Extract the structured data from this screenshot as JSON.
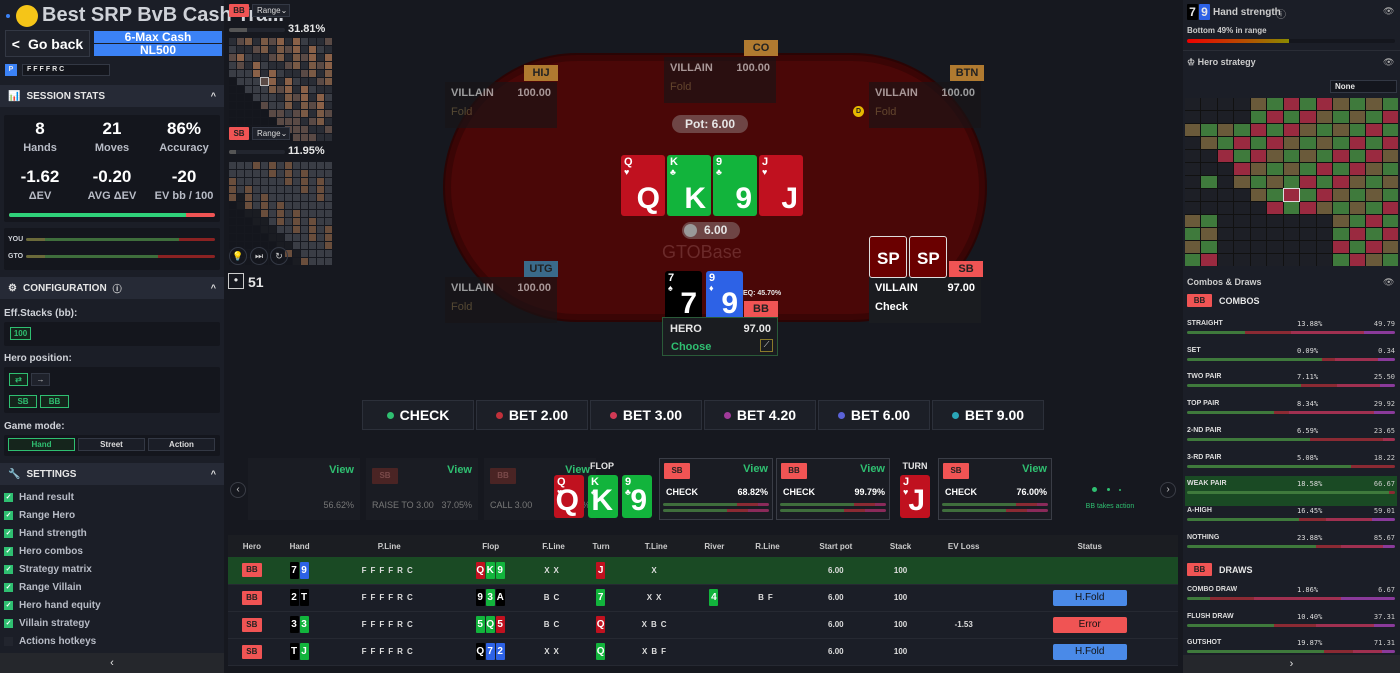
{
  "header": {
    "title": "Best SRP BvB Cash Tra...",
    "go_back": "Go back",
    "game_type": "6-Max Cash",
    "stakes": "NL500",
    "line_badge": "P",
    "line": "FFFFRC"
  },
  "session_stats": {
    "title": "SESSION STATS",
    "stats": [
      {
        "value": "8",
        "label": "Hands"
      },
      {
        "value": "21",
        "label": "Moves"
      },
      {
        "value": "86%",
        "label": "Accuracy"
      },
      {
        "value": "-1.62",
        "label": "ΔEV"
      },
      {
        "value": "-0.20",
        "label": "AVG ΔEV"
      },
      {
        "value": "-20",
        "label": "EV bb / 100"
      }
    ],
    "accuracy_fraction": 0.86,
    "you_label": "YOU",
    "gto_label": "GTO"
  },
  "configuration": {
    "title": "CONFIGURATION",
    "eff_stacks_label": "Eff.Stacks (bb):",
    "eff_stacks": "100",
    "hero_position_label": "Hero position:",
    "positions": [
      "SB",
      "BB"
    ],
    "game_mode_label": "Game mode:",
    "modes": [
      "Hand",
      "Street",
      "Action"
    ],
    "active_mode": "Hand"
  },
  "settings": {
    "title": "SETTINGS",
    "items": [
      {
        "label": "Hand result",
        "checked": true
      },
      {
        "label": "Range Hero",
        "checked": true
      },
      {
        "label": "Hand strength",
        "checked": true
      },
      {
        "label": "Hero combos",
        "checked": true
      },
      {
        "label": "Strategy matrix",
        "checked": true
      },
      {
        "label": "Range Villain",
        "checked": true
      },
      {
        "label": "Hero hand equity",
        "checked": true
      },
      {
        "label": "Villain strategy",
        "checked": true
      },
      {
        "label": "Actions hotkeys",
        "checked": false
      }
    ]
  },
  "ranges": [
    {
      "pos": "BB",
      "select": "Range",
      "pct": "31.81%",
      "fill": 0.3181
    },
    {
      "pos": "SB",
      "select": "Range",
      "pct": "11.95%",
      "fill": 0.1195
    }
  ],
  "counter": "51",
  "table": {
    "pot": "Pot: 6.00",
    "bet": "6.00",
    "logo": "GTOBase",
    "seats": [
      {
        "pos": "HIJ",
        "name": "VILLAIN",
        "stack": "100.00",
        "action": "Fold"
      },
      {
        "pos": "CO",
        "name": "VILLAIN",
        "stack": "100.00",
        "action": "Fold"
      },
      {
        "pos": "BTN",
        "name": "VILLAIN",
        "stack": "100.00",
        "action": "Fold"
      },
      {
        "pos": "UTG",
        "name": "VILLAIN",
        "stack": "100.00",
        "action": "Fold"
      },
      {
        "pos": "SB",
        "name": "VILLAIN",
        "stack": "97.00",
        "action": "Check"
      }
    ],
    "hero": {
      "pos": "BB",
      "name": "HERO",
      "stack": "97.00",
      "action": "Choose",
      "equity": "EQ: 45.70%",
      "cards": [
        {
          "rank": "7",
          "suit": "s"
        },
        {
          "rank": "9",
          "suit": "d"
        }
      ]
    },
    "dealer": "D",
    "villain_cards": [
      "SP",
      "SP"
    ],
    "board": [
      {
        "rank": "Q",
        "suit": "h"
      },
      {
        "rank": "K",
        "suit": "c"
      },
      {
        "rank": "9",
        "suit": "c"
      },
      {
        "rank": "J",
        "suit": "h"
      }
    ]
  },
  "actions": [
    {
      "label": "CHECK",
      "color": "#2fbf71"
    },
    {
      "label": "BET 2.00",
      "color": "#c0303a"
    },
    {
      "label": "BET 3.00",
      "color": "#d13a55"
    },
    {
      "label": "BET 4.20",
      "color": "#a03a9a"
    },
    {
      "label": "BET 6.00",
      "color": "#5a62d8"
    },
    {
      "label": "BET 9.00",
      "color": "#2aa6b8"
    }
  ],
  "timeline": {
    "view": "View",
    "preflop": [
      {
        "pos": "",
        "action": "",
        "pct": "56.62%"
      },
      {
        "pos": "SB",
        "action": "RAISE TO 3.00",
        "pct": "37.05%"
      },
      {
        "pos": "BB",
        "action": "CALL 3.00",
        "pct": "40.84%"
      }
    ],
    "flop_label": "FLOP",
    "turn_label": "TURN",
    "flop": [
      {
        "rank": "Q",
        "suit": "h"
      },
      {
        "rank": "K",
        "suit": "c"
      },
      {
        "rank": "9",
        "suit": "c"
      }
    ],
    "turn": [
      {
        "rank": "J",
        "suit": "h"
      }
    ],
    "street_actions": [
      {
        "pos": "SB",
        "action": "CHECK",
        "pct": "68.82%"
      },
      {
        "pos": "BB",
        "action": "CHECK",
        "pct": "99.79%"
      },
      {
        "pos": "SB",
        "action": "CHECK",
        "pct": "76.00%"
      }
    ],
    "status": "BB takes action"
  },
  "history": {
    "columns": [
      "Hero",
      "Hand",
      "P.Line",
      "Flop",
      "F.Line",
      "Turn",
      "T.Line",
      "River",
      "R.Line",
      "Start pot",
      "Stack",
      "EV Loss",
      "Status"
    ],
    "rows": [
      {
        "hero": "BB",
        "hand": [
          [
            "7",
            "s"
          ],
          [
            "9",
            "d"
          ]
        ],
        "pline": "FFFFRC",
        "flop": [
          [
            "Q",
            "h"
          ],
          [
            "K",
            "c"
          ],
          [
            "9",
            "c"
          ]
        ],
        "fline": "XX",
        "turn": [
          [
            "J",
            "h"
          ]
        ],
        "tline": "X",
        "river": [],
        "rline": "",
        "pot": "6.00",
        "stack": "100",
        "ev": "",
        "status": "",
        "current": true
      },
      {
        "hero": "BB",
        "hand": [
          [
            "2",
            "s"
          ],
          [
            "T",
            "s"
          ]
        ],
        "pline": "FFFFRC",
        "flop": [
          [
            "9",
            "s"
          ],
          [
            "3",
            "c"
          ],
          [
            "A",
            "s"
          ]
        ],
        "fline": "BC",
        "turn": [
          [
            "7",
            "c"
          ]
        ],
        "tline": "XX",
        "river": [
          [
            "4",
            "c"
          ]
        ],
        "rline": "BF",
        "pot": "6.00",
        "stack": "100",
        "ev": "",
        "status": "H.Fold"
      },
      {
        "hero": "SB",
        "hand": [
          [
            "3",
            "s"
          ],
          [
            "3",
            "c"
          ]
        ],
        "pline": "FFFFRC",
        "flop": [
          [
            "5",
            "c"
          ],
          [
            "Q",
            "c"
          ],
          [
            "5",
            "h"
          ]
        ],
        "fline": "BC",
        "turn": [
          [
            "Q",
            "h"
          ]
        ],
        "tline": "XBC",
        "river": [],
        "rline": "",
        "pot": "6.00",
        "stack": "100",
        "ev": "-1.53",
        "status": "Error"
      },
      {
        "hero": "SB",
        "hand": [
          [
            "T",
            "s"
          ],
          [
            "J",
            "c"
          ]
        ],
        "pline": "FFFFRC",
        "flop": [
          [
            "Q",
            "s"
          ],
          [
            "7",
            "d"
          ],
          [
            "2",
            "d"
          ]
        ],
        "fline": "XX",
        "turn": [
          [
            "Q",
            "c"
          ]
        ],
        "tline": "XBF",
        "river": [],
        "rline": "",
        "pot": "6.00",
        "stack": "100",
        "ev": "",
        "status": "H.Fold"
      }
    ]
  },
  "right": {
    "hand": [
      {
        "rank": "7",
        "suit": "s"
      },
      {
        "rank": "9",
        "suit": "d"
      }
    ],
    "hand_strength_title": "Hand strength",
    "hand_strength_text": "Bottom 49% in range",
    "hand_strength_fraction": 0.49,
    "hero_strategy_title": "Hero strategy",
    "strategy_select": "None",
    "combos_draws_title": "Combos & Draws",
    "pos": "BB",
    "combos_label": "COMBOS",
    "draws_label": "DRAWS",
    "combos": [
      {
        "name": "STRAIGHT",
        "pct": "13.88%",
        "count": "49.79",
        "mix": [
          28,
          22,
          35,
          15
        ]
      },
      {
        "name": "SET",
        "pct": "0.09%",
        "count": "0.34",
        "mix": [
          65,
          6,
          21,
          8
        ]
      },
      {
        "name": "TWO PAIR",
        "pct": "7.11%",
        "count": "25.50",
        "mix": [
          55,
          17,
          21,
          7
        ]
      },
      {
        "name": "TOP PAIR",
        "pct": "8.34%",
        "count": "29.92",
        "mix": [
          42,
          7,
          41,
          10
        ]
      },
      {
        "name": "2-ND PAIR",
        "pct": "6.59%",
        "count": "23.65",
        "mix": [
          59,
          35,
          6,
          0
        ]
      },
      {
        "name": "3-RD PAIR",
        "pct": "5.08%",
        "count": "18.22",
        "mix": [
          79,
          21,
          0,
          0
        ]
      },
      {
        "name": "WEAK PAIR",
        "pct": "18.58%",
        "count": "66.67",
        "mix": [
          97,
          3,
          0,
          0
        ],
        "highlight": true
      },
      {
        "name": "A-HIGH",
        "pct": "16.45%",
        "count": "59.01",
        "mix": [
          54,
          13,
          22,
          11
        ]
      },
      {
        "name": "NOTHING",
        "pct": "23.88%",
        "count": "85.67",
        "mix": [
          62,
          12,
          20,
          6
        ]
      }
    ],
    "draws": [
      {
        "name": "COMBO DRAW",
        "pct": "1.86%",
        "count": "6.67",
        "mix": [
          11,
          21,
          42,
          26
        ]
      },
      {
        "name": "FLUSH DRAW",
        "pct": "10.40%",
        "count": "37.31",
        "mix": [
          42,
          20,
          28,
          10
        ]
      },
      {
        "name": "GUTSHOT",
        "pct": "19.87%",
        "count": "71.31",
        "mix": [
          66,
          14,
          14,
          6
        ]
      }
    ]
  },
  "colors": {
    "accent": "#2fbf71",
    "blue": "#3b82f6",
    "red": "#f05454",
    "felt": "#4a0707"
  }
}
